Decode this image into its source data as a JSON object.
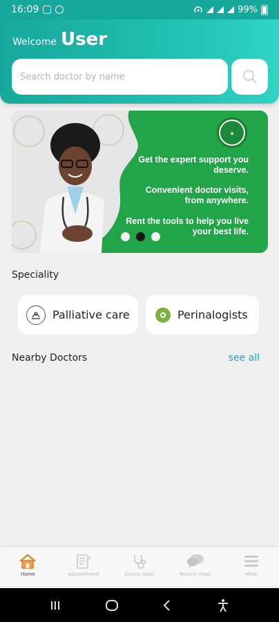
{
  "status_bar": {
    "time": "16:09",
    "battery": "99%"
  },
  "header": {
    "welcome_label": "Welcome",
    "user_name": "User",
    "search_placeholder": "Search doctor by name"
  },
  "banner": {
    "line1": "Get the expert support you deserve.",
    "line2": "Convenient doctor visits, from anywhere.",
    "line3": "Rent the tools to help you live your best life.",
    "dots": [
      {
        "active": false
      },
      {
        "active": true
      },
      {
        "active": false
      }
    ]
  },
  "speciality": {
    "title": "Speciality",
    "items": [
      {
        "label": "Palliative care",
        "icon": "palliative-care-icon"
      },
      {
        "label": "Perinalogists",
        "icon": "perinalogists-icon"
      }
    ]
  },
  "nearby": {
    "title": "Nearby Doctors",
    "see_all": "see all"
  },
  "bottom_nav": {
    "items": [
      {
        "label": "Home",
        "icon": "home-icon",
        "active": true
      },
      {
        "label": "Appointment",
        "icon": "appointment-icon",
        "active": false
      },
      {
        "label": "Doctor login",
        "icon": "stethoscope-icon",
        "active": false
      },
      {
        "label": "Recent chats",
        "icon": "chat-icon",
        "active": false
      },
      {
        "label": "More",
        "icon": "menu-icon",
        "active": false
      }
    ]
  },
  "colors": {
    "header_start": "#17a89c",
    "header_end": "#2fd3c4",
    "banner_green": "#22a449",
    "home_accent": "#f0a04b",
    "link": "#1aa7c9"
  }
}
